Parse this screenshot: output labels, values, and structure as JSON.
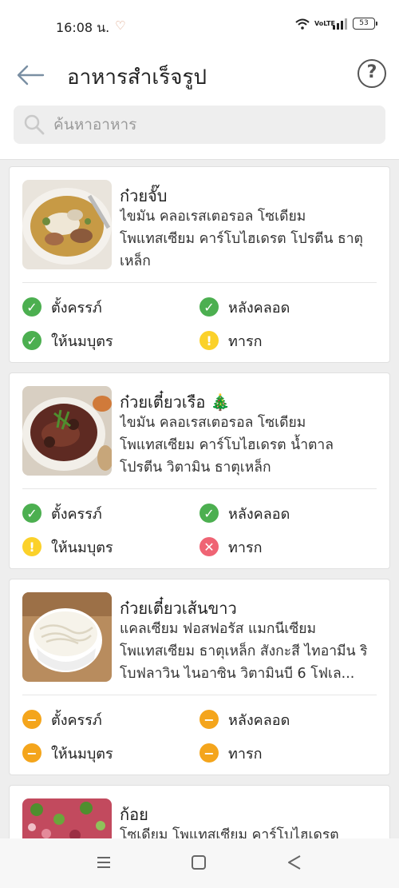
{
  "status_bar": {
    "time": "16:08 น.",
    "battery": "53",
    "network": "VoLTE"
  },
  "app_bar": {
    "title": "อาหารสำเร็จรูป",
    "back_icon": "arrow-left-icon",
    "help_icon": "question-circle-icon"
  },
  "search": {
    "placeholder": "ค้นหาอาหาร",
    "value": ""
  },
  "labels": {
    "pregnant": "ตั้งครรภ์",
    "postpartum": "หลังคลอด",
    "breastfeeding": "ให้นมบุตร",
    "infant": "ทารก"
  },
  "status_colors": {
    "ok": "#4caf50",
    "caution": "#fbd12a",
    "avoid": "#ef6474",
    "no_data": "#f4a51c"
  },
  "foods": [
    {
      "name": "ก๋วยจั๊บ",
      "nutrients": "ไขมัน คลอเรสเตอรอล โซเดียม โพแทสเซียม คาร์โบไฮเดรต โปรตีน ธาตุเหล็ก",
      "status": {
        "pregnant": "ok",
        "postpartum": "ok",
        "breastfeeding": "ok",
        "infant": "caution"
      }
    },
    {
      "name": "ก๋วยเตี๋ยวเรือ 🎄",
      "nutrients": "ไขมัน คลอเรสเตอรอล โซเดียม โพแทสเซียม คาร์โบไฮเดรต น้ำตาล โปรตีน วิตามิน ธาตุเหล็ก",
      "status": {
        "pregnant": "ok",
        "postpartum": "ok",
        "breastfeeding": "caution",
        "infant": "avoid"
      }
    },
    {
      "name": "ก๋วยเตี๋ยวเส้นขาว",
      "nutrients": "แคลเซียม ฟอสฟอรัส แมกนีเซียม โพแทสเซียม ธาตุเหล็ก สังกะสี ไทอามีน ริโบฟลาวิน ไนอาซิน วิตามินบี 6 โฟเล...",
      "status": {
        "pregnant": "no_data",
        "postpartum": "no_data",
        "breastfeeding": "no_data",
        "infant": "no_data"
      }
    },
    {
      "name": "ก้อย",
      "nutrients": "โซเดียม โพแทสเซียม คาร์โบไฮเดรต",
      "status": {}
    }
  ],
  "nav_bar": {
    "menu_icon": "menu-icon",
    "home_icon": "home-square-icon",
    "back_icon": "triangle-back-icon"
  }
}
